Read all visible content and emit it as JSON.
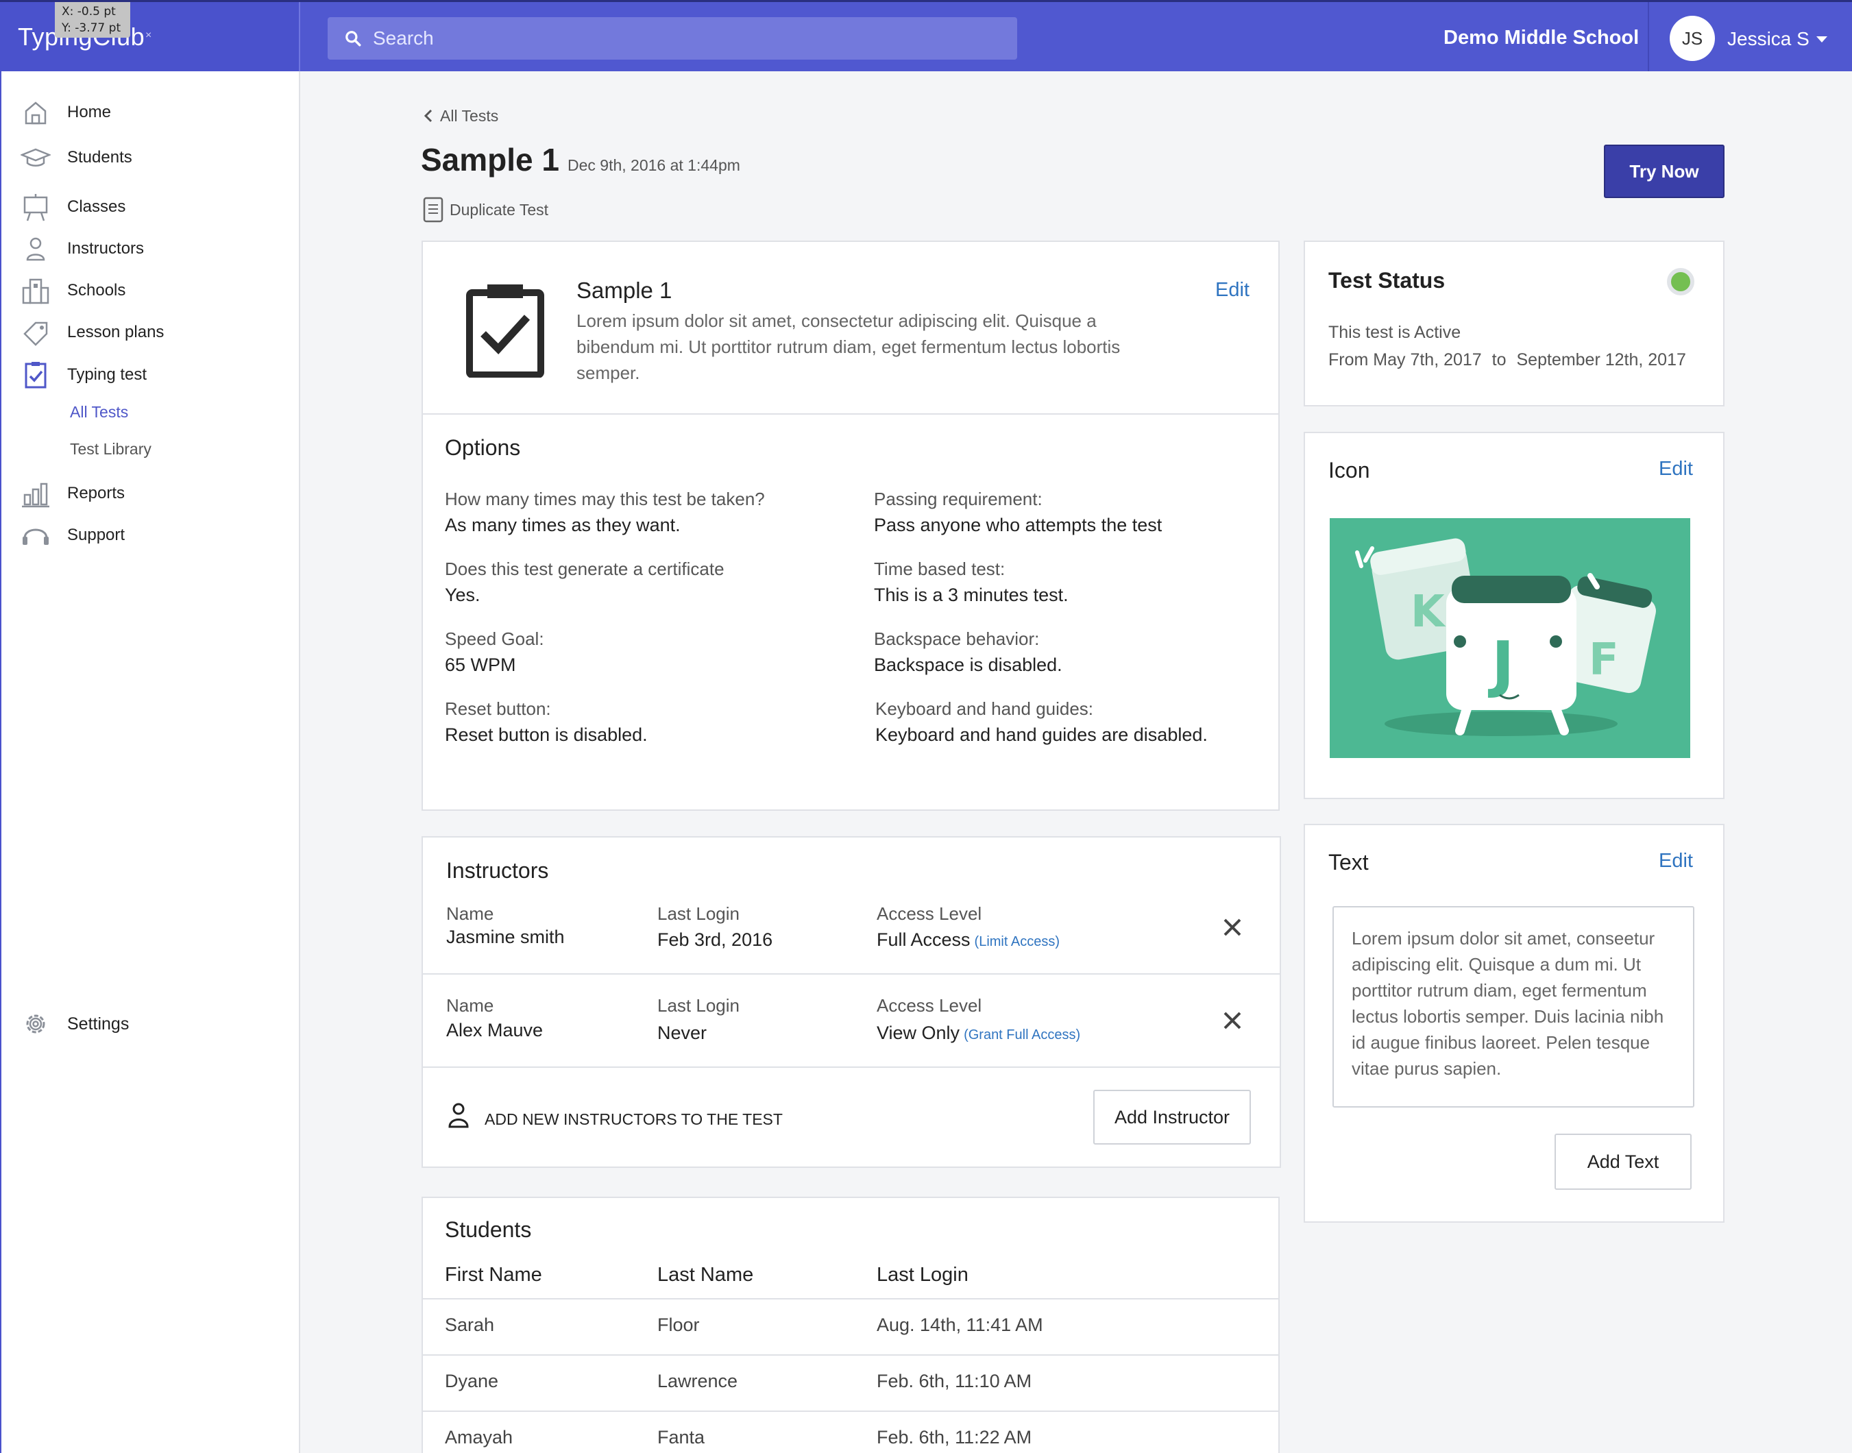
{
  "app": {
    "brand": "TypingClub",
    "brand_mark": "×",
    "coord_x": "X: -0.5 pt",
    "coord_y": "Y: -3.77 pt"
  },
  "topbar": {
    "search_placeholder": "Search",
    "school": "Demo Middle School",
    "user_initials": "JS",
    "user_name": "Jessica S"
  },
  "sidebar": {
    "items": [
      {
        "label": "Home",
        "icon": "home-icon"
      },
      {
        "label": "Students",
        "icon": "graduation-cap-icon"
      },
      {
        "label": "Classes",
        "icon": "easel-icon"
      },
      {
        "label": "Instructors",
        "icon": "person-icon"
      },
      {
        "label": "Schools",
        "icon": "building-icon"
      },
      {
        "label": "Lesson plans",
        "icon": "tag-icon"
      },
      {
        "label": "Typing test",
        "icon": "clipboard-check-icon"
      },
      {
        "label": "Reports",
        "icon": "bar-chart-icon"
      },
      {
        "label": "Support",
        "icon": "headset-icon"
      },
      {
        "label": "Settings",
        "icon": "gear-icon"
      }
    ],
    "sub_items": [
      "All Tests",
      "Test Library"
    ]
  },
  "header": {
    "back_label": "All Tests",
    "title": "Sample 1",
    "date": "Dec 9th, 2016 at 1:44pm",
    "duplicate_label": "Duplicate Test",
    "try_now": "Try Now"
  },
  "test_card": {
    "name": "Sample 1",
    "description": "Lorem ipsum dolor sit amet, consectetur adipiscing elit. Quisque a bibendum mi. Ut porttitor rutrum diam, eget fermentum lectus lobortis semper.",
    "edit": "Edit",
    "options_title": "Options",
    "options": [
      {
        "label": "How many times may this test be taken?",
        "value": "As many times as they want."
      },
      {
        "label": "Passing requirement:",
        "value": "Pass anyone who attempts the test"
      },
      {
        "label": "Does this test generate a certificate",
        "value": "Yes."
      },
      {
        "label": "Time based test:",
        "value": "This is a 3 minutes test."
      },
      {
        "label": "Speed Goal:",
        "value": "65 WPM"
      },
      {
        "label": "Backspace behavior:",
        "value": "Backspace is disabled."
      },
      {
        "label": "Reset button:",
        "value": "Reset button is disabled."
      },
      {
        "label": "Keyboard and hand guides:",
        "value": "Keyboard and hand guides are disabled."
      }
    ]
  },
  "instructors": {
    "title": "Instructors",
    "col_name": "Name",
    "col_login": "Last Login",
    "col_access": "Access Level",
    "rows": [
      {
        "name": "Jasmine smith",
        "last_login": "Feb 3rd, 2016",
        "access": "Full Access",
        "access_link": "(Limit Access)"
      },
      {
        "name": "Alex Mauve",
        "last_login": "Never",
        "access": "View Only",
        "access_link": "(Grant Full Access)"
      }
    ],
    "add_prompt": "ADD NEW INSTRUCTORS TO THE TEST",
    "add_button": "Add Instructor"
  },
  "students": {
    "title": "Students",
    "headers": [
      "First Name",
      "Last Name",
      "Last Login"
    ],
    "rows": [
      {
        "first": "Sarah",
        "last": "Floor",
        "login": "Aug. 14th, 11:41 AM"
      },
      {
        "first": "Dyane",
        "last": "Lawrence",
        "login": "Feb. 6th, 11:10 AM"
      },
      {
        "first": "Amayah",
        "last": "Fanta",
        "login": "Feb. 6th, 11:22 AM"
      }
    ]
  },
  "status": {
    "title": "Test Status",
    "active_text": "This test is Active",
    "from_text": "From May 7th, 2017",
    "to_word": "to",
    "to_text": "September 12th, 2017",
    "status_color": "#74bf52"
  },
  "icon_card": {
    "title": "Icon",
    "edit": "Edit",
    "keys": [
      "K",
      "J",
      "F"
    ],
    "bg_color": "#4db893"
  },
  "text_card": {
    "title": "Text",
    "edit": "Edit",
    "content": "Lorem ipsum dolor sit amet, conseetur adipiscing elit. Quisque a dum mi. Ut porttitor rutrum diam, eget fermentum lectus lobortis semper. Duis lacinia nibh id augue finibus laoreet. Pelen tesque vitae purus sapien.",
    "add_button": "Add Text"
  },
  "colors": {
    "primary": "#5058d0",
    "accent_link": "#2f74c0",
    "button_dark": "#3a3fa8"
  }
}
